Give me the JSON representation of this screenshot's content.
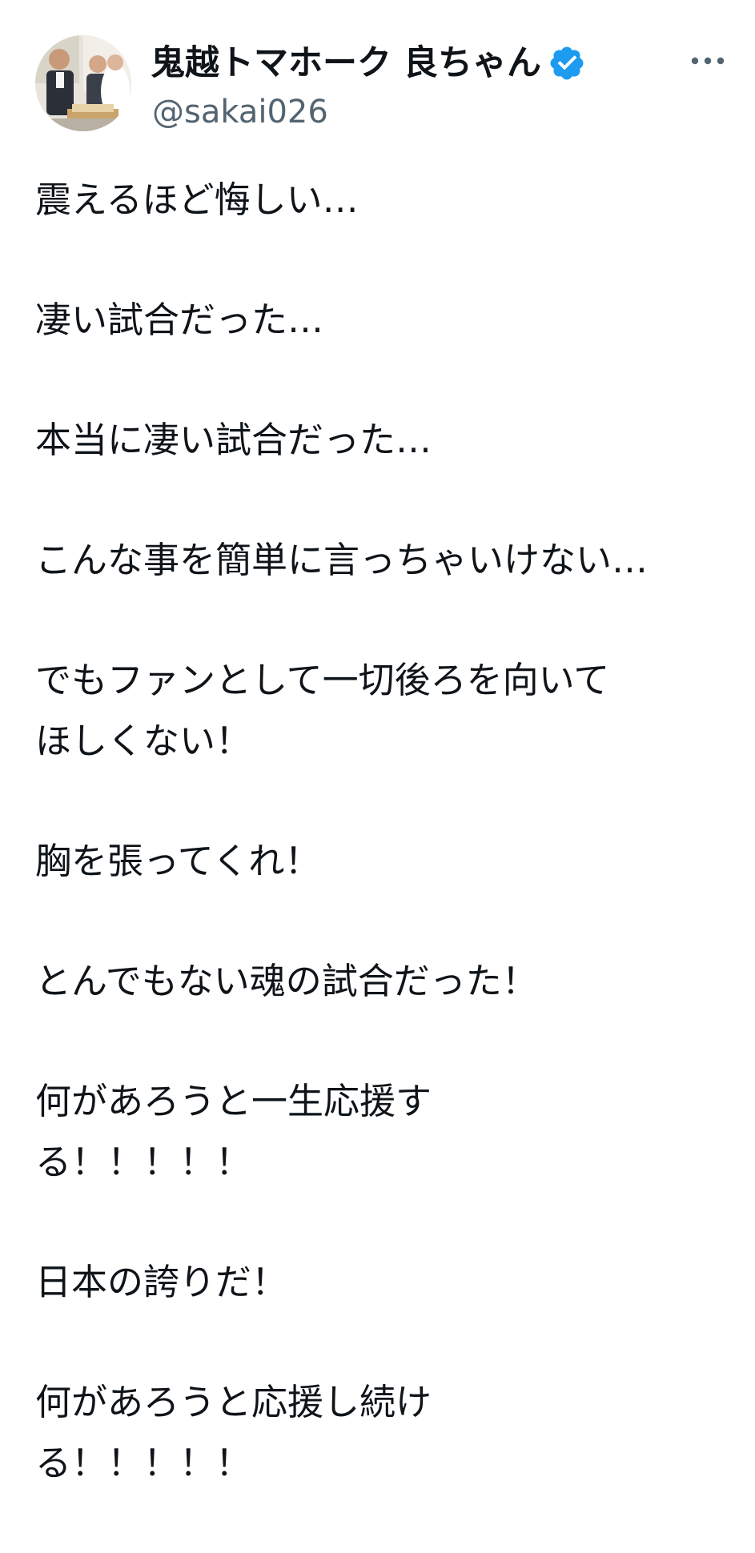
{
  "author": {
    "display_name": "鬼越トマホーク 良ちゃん",
    "handle": "@sakai026",
    "verified": true,
    "verified_color": "#1d9bf0",
    "avatar_icon": "profile-photo"
  },
  "menu": {
    "more_icon": "more-horizontal-icon"
  },
  "tweet": {
    "paragraphs": [
      [
        "震えるほど悔しい…"
      ],
      [
        "凄い試合だった…"
      ],
      [
        "本当に凄い試合だった…"
      ],
      [
        "こんな事を簡単に言っちゃいけない…"
      ],
      [
        "でもファンとして一切後ろを向いて",
        "ほしくない！"
      ],
      [
        "胸を張ってくれ！"
      ],
      [
        "とんでもない魂の試合だった！"
      ],
      [
        "何があろうと一生応援す",
        "る！！！！！"
      ],
      [
        "日本の誇りだ！"
      ],
      [
        "何があろうと応援し続け",
        "る！！！！！"
      ]
    ]
  },
  "colors": {
    "text": "#0f1419",
    "secondary_text": "#536471",
    "accent": "#1d9bf0"
  }
}
